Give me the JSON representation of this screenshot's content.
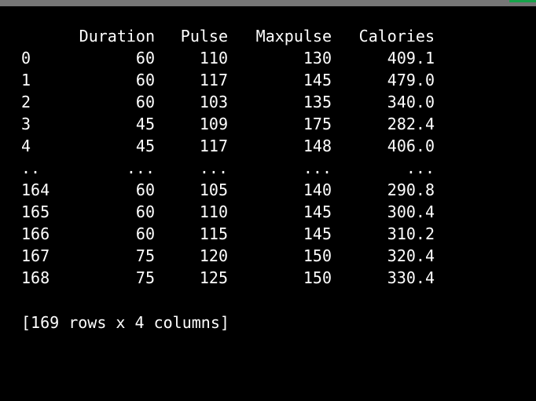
{
  "console": {
    "columns": [
      "Duration",
      "Pulse",
      "Maxpulse",
      "Calories"
    ],
    "rows": [
      {
        "index": "0",
        "values": [
          "60",
          "110",
          "130",
          "409.1"
        ]
      },
      {
        "index": "1",
        "values": [
          "60",
          "117",
          "145",
          "479.0"
        ]
      },
      {
        "index": "2",
        "values": [
          "60",
          "103",
          "135",
          "340.0"
        ]
      },
      {
        "index": "3",
        "values": [
          "45",
          "109",
          "175",
          "282.4"
        ]
      },
      {
        "index": "4",
        "values": [
          "45",
          "117",
          "148",
          "406.0"
        ]
      },
      {
        "index": "..",
        "values": [
          "...",
          "...",
          "...",
          "..."
        ]
      },
      {
        "index": "164",
        "values": [
          "60",
          "105",
          "140",
          "290.8"
        ]
      },
      {
        "index": "165",
        "values": [
          "60",
          "110",
          "145",
          "300.4"
        ]
      },
      {
        "index": "166",
        "values": [
          "60",
          "115",
          "145",
          "310.2"
        ]
      },
      {
        "index": "167",
        "values": [
          "75",
          "120",
          "150",
          "320.4"
        ]
      },
      {
        "index": "168",
        "values": [
          "75",
          "125",
          "150",
          "330.4"
        ]
      }
    ],
    "summary": "[169 rows x 4 columns]"
  },
  "colors": {
    "background": "#000000",
    "text": "#ffffff",
    "title_bar": "#767676",
    "accent": "#16a34a"
  }
}
